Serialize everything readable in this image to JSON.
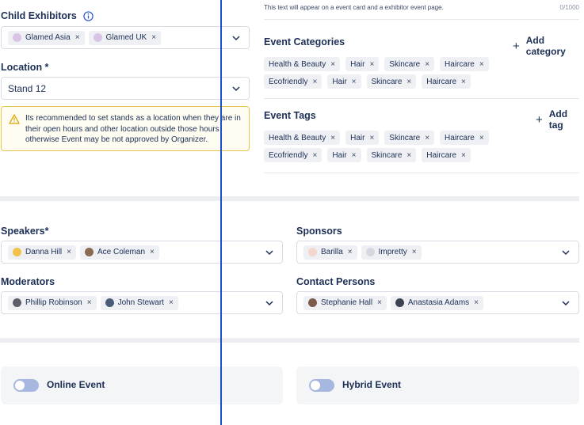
{
  "left": {
    "child_exhibitors": {
      "label": "Child Exhibitors",
      "chips": [
        "Glamed Asia",
        "Glamed UK"
      ]
    },
    "location": {
      "label": "Location *",
      "value": "Stand 12"
    },
    "warning": {
      "text": "Its recommended to set stands as a location when they are in their open hours and other location outside those hours otherwise Event may be not approved by Organizer."
    }
  },
  "right": {
    "helper_text": "This text will appear on a event card and a exhibitor event  page.",
    "char_count": "0/1000",
    "categories": {
      "label": "Event Categories",
      "add_label": "Add category",
      "row1": [
        "Health & Beauty",
        "Hair",
        "Skincare",
        "Haircare"
      ],
      "row2": [
        "Ecofriendly",
        "Hair",
        "Skincare",
        "Haircare"
      ]
    },
    "tags": {
      "label": "Event Tags",
      "add_label": "Add tag",
      "row1": [
        "Health & Beauty",
        "Hair",
        "Skincare",
        "Haircare"
      ],
      "row2": [
        "Ecofriendly",
        "Hair",
        "Skincare",
        "Haircare"
      ]
    }
  },
  "people": {
    "speakers": {
      "label": "Speakers*",
      "chips": [
        "Danna Hill",
        "Ace Coleman"
      ]
    },
    "sponsors": {
      "label": "Sponsors",
      "chips": [
        "Barilla",
        "Impretty"
      ]
    },
    "moderators": {
      "label": "Moderators",
      "chips": [
        "Phillip Robinson",
        "John Stewart"
      ]
    },
    "contacts": {
      "label": "Contact Persons",
      "chips": [
        "Stephanie Hall",
        "Anastasia Adams"
      ]
    }
  },
  "toggles": {
    "online": "Online Event",
    "hybrid": "Hybrid Event"
  },
  "remove_glyph": "×",
  "colors": {
    "accent": "#1f4fc8",
    "toggle_off": "#a7b8e0",
    "warning_border": "#e8c547",
    "warning_bg": "#fffdf2"
  }
}
